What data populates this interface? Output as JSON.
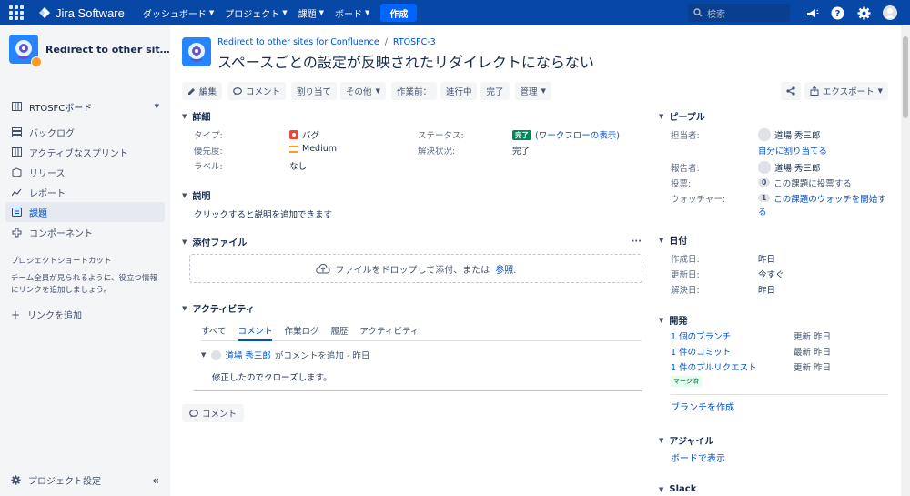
{
  "topbar": {
    "product": "Jira Software",
    "nav": [
      "ダッシュボード",
      "プロジェクト",
      "課題",
      "ボード"
    ],
    "create": "作成",
    "search_placeholder": "検索"
  },
  "sidebar": {
    "project_name": "Redirect to other sit…",
    "board": "RTOSFCボード",
    "items": [
      {
        "label": "バックログ",
        "icon": "backlog-icon"
      },
      {
        "label": "アクティブなスプリント",
        "icon": "board-icon"
      },
      {
        "label": "リリース",
        "icon": "release-icon"
      },
      {
        "label": "レポート",
        "icon": "report-icon"
      },
      {
        "label": "課題",
        "icon": "issues-icon"
      },
      {
        "label": "コンポーネント",
        "icon": "component-icon"
      }
    ],
    "shortcut_heading": "プロジェクトショートカット",
    "shortcut_note": "チーム全員が見られるように、役立つ情報にリンクを追加しましょう。",
    "add_link": "リンクを追加",
    "settings": "プロジェクト設定"
  },
  "issue": {
    "breadcrumb_project": "Redirect to other sites for Confluence",
    "breadcrumb_key": "RTOSFC-3",
    "title": "スペースごとの設定が反映されたリダイレクトにならない"
  },
  "toolbar": {
    "edit": "編集",
    "comment": "コメント",
    "assign": "割り当て",
    "more": "その他",
    "workflow_label": "作業前：",
    "in_progress": "進行中",
    "done": "完了",
    "admin": "管理",
    "export": "エクスポート"
  },
  "details": {
    "heading": "詳細",
    "type_label": "タイプ:",
    "type_value": "バグ",
    "priority_label": "優先度:",
    "priority_value": "Medium",
    "labels_label": "ラベル:",
    "labels_value": "なし",
    "status_label": "ステータス:",
    "status_value": "完了",
    "workflow_link": "(ワークフローの表示)",
    "resolution_label": "解決状況:",
    "resolution_value": "完了"
  },
  "description": {
    "heading": "説明",
    "placeholder": "クリックすると説明を追加できます"
  },
  "attachments": {
    "heading": "添付ファイル",
    "drop_text": "ファイルをドロップして添付、または",
    "browse": "参照."
  },
  "activity": {
    "heading": "アクティビティ",
    "tabs": [
      "すべて",
      "コメント",
      "作業ログ",
      "履歴",
      "アクティビティ"
    ],
    "active_tab": "コメント",
    "comment_author": "道場 秀三郎",
    "comment_action": "がコメントを追加 - 昨日",
    "comment_body": "修正したのでクローズします。",
    "comment_button": "コメント"
  },
  "people": {
    "heading": "ピープル",
    "assignee_label": "担当者:",
    "assignee": "道場 秀三郎",
    "assign_me": "自分に割り当てる",
    "reporter_label": "報告者:",
    "reporter": "道場 秀三郎",
    "votes_label": "投票:",
    "votes_count": "0",
    "vote_link": "この課題に投票する",
    "watchers_label": "ウォッチャー:",
    "watchers_count": "1",
    "watch_link_line1": "この課題のウォッチを開始す",
    "watch_link_line2": "る"
  },
  "dates": {
    "heading": "日付",
    "created_label": "作成日:",
    "created": "昨日",
    "updated_label": "更新日:",
    "updated": "今すぐ",
    "resolved_label": "解決日:",
    "resolved": "昨日"
  },
  "development": {
    "heading": "開発",
    "branch": "1 個のブランチ",
    "branch_meta": "更新 昨日",
    "commit": "1 件のコミット",
    "commit_meta": "最新 昨日",
    "pr": "1 件のプルリクエスト",
    "pr_meta": "更新 昨日",
    "merged": "マージ済",
    "create_branch": "ブランチを作成"
  },
  "agile": {
    "heading": "アジャイル",
    "view_on_board": "ボードで表示"
  },
  "slack": {
    "heading": "Slack"
  }
}
